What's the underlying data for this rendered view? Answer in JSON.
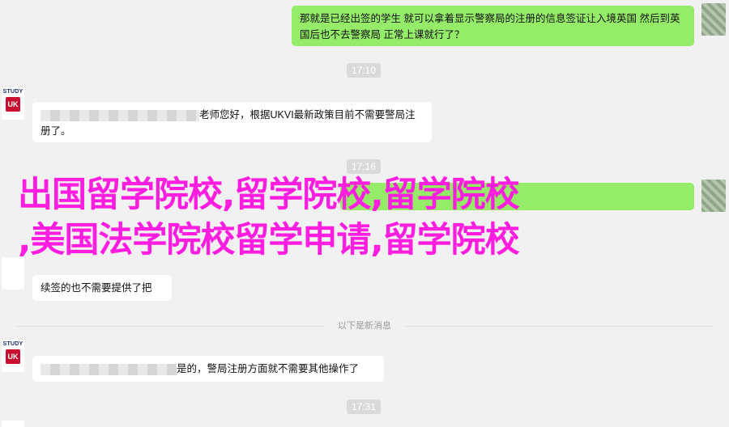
{
  "messages": {
    "msg1": "那就是已经出签的学生 就可以拿着显示警察局的注册的信息签证让入境英国 然后到英国后也不去警察局 正常上课就行了？",
    "time1": "17:10",
    "msg2": "老师您好，根据UKVI最新政策目前不需要警局注册了。",
    "time2": "17:16",
    "msg3": "续签的也不需要提供了把",
    "divider": "以下是新消息",
    "msg4": "是的，警局注册方面就不需要其他操作了",
    "time3": "17:31"
  },
  "avatar": {
    "study_label": "STUDY",
    "uk_label": "UK"
  },
  "overlay": {
    "line1": "出国留学院校,留学院校,留学院校",
    "line2": ",美国法学院校留学申请,留学院校"
  },
  "colors": {
    "overlay": "#ff1de0",
    "bubble_right": "#95ec69",
    "bubble_left": "#ffffff"
  }
}
